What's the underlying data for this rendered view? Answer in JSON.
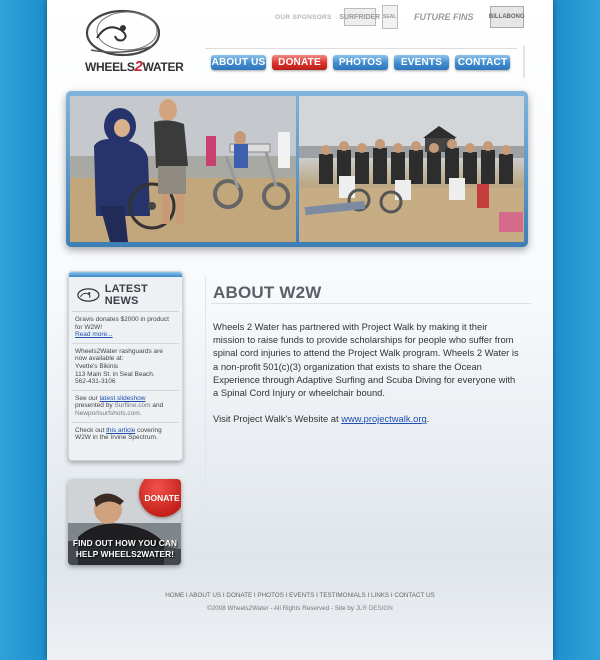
{
  "logo": {
    "text_left": "WHEELS",
    "text_mid": "2",
    "text_right": "WATER"
  },
  "sponsors": {
    "label": "OUR SPONSORS",
    "items": [
      "SURFRIDER",
      "SEAL",
      "FUTURE FINS",
      "BILLABONG"
    ]
  },
  "nav": {
    "items": [
      "ABOUT US",
      "DONATE",
      "PHOTOS",
      "EVENTS",
      "CONTACT"
    ]
  },
  "news": {
    "title": "LATEST NEWS",
    "item1_text": "Gravis donates $2000 in product for W2W!",
    "item1_link": "Read more...",
    "item2_line1": "Wheels2Water rashguards are now available at:",
    "item2_line2": "Yvette's Bikinis",
    "item2_line3": "113 Main St. in Seal Beach.",
    "item2_line4": "562-431-3106",
    "item3_pre": "See our",
    "item3_link": "latest slideshow",
    "item3_mid": "presented by",
    "item3_src1": "Surfline.com",
    "item3_and": "and",
    "item3_src2": "Newportsurfshots.com.",
    "item4_pre": "Check out",
    "item4_link": "this article",
    "item4_post": "covering W2W in the Irvine Spectrum."
  },
  "donate_card": {
    "badge": "DONATE",
    "caption": "FIND OUT HOW YOU CAN HELP WHEELS2WATER!"
  },
  "main": {
    "title": "ABOUT W2W",
    "paragraph1": "Wheels 2 Water has partnered with Project Walk by making it their mission to raise funds to provide scholarships for people who suffer from spinal cord injuries to attend the Project Walk program.  Wheels 2 Water is a non-profit 501(c)(3) organization that exists to share the Ocean Experience through Adaptive Surfing and Scuba Diving for everyone with a Spinal Cord Injury or wheelchair bound.",
    "paragraph2_pre": "Visit Project Walk's Website at",
    "paragraph2_link": "www.projectwalk.org",
    "paragraph2_post": "."
  },
  "footer": {
    "links": [
      "HOME",
      "ABOUT US",
      "DONATE",
      "PHOTOS",
      "EVENTS",
      "TESTIMONIALS",
      "LINKS",
      "CONTACT US"
    ],
    "separator": "I",
    "copyright_pre": "©2008 Wheels2Water - All Rights Reserved - Site by",
    "copyright_link": "JLR DESIGN"
  },
  "colors": {
    "nav_blue": "#3f8bd0",
    "donate_red": "#d9312b",
    "link": "#1d4fb0",
    "background": "#1a86c7"
  }
}
